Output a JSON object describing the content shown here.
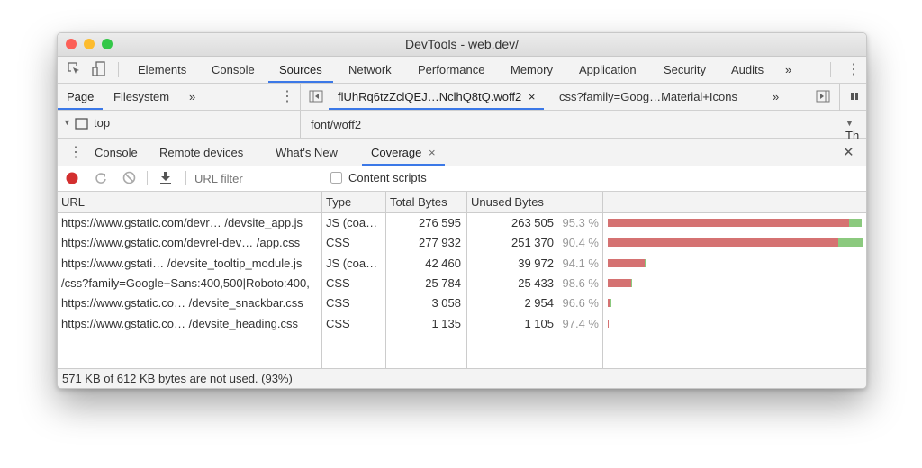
{
  "window": {
    "title": "DevTools - web.dev/",
    "traffic_lights": {
      "close": "#fc5f57",
      "minimize": "#fdbc2e",
      "zoom": "#33c748"
    }
  },
  "main_tabs": {
    "items": [
      {
        "label": "Elements"
      },
      {
        "label": "Console"
      },
      {
        "label": "Sources",
        "active": true
      },
      {
        "label": "Network"
      },
      {
        "label": "Performance"
      },
      {
        "label": "Memory"
      },
      {
        "label": "Application"
      },
      {
        "label": "Security"
      },
      {
        "label": "Audits"
      }
    ],
    "overflow": "»",
    "menu": "⋮"
  },
  "sources": {
    "nav_tabs": [
      {
        "label": "Page",
        "active": true
      },
      {
        "label": "Filesystem"
      }
    ],
    "nav_overflow": "»",
    "file_tabs": [
      {
        "label": "flUhRq6tzZclQEJ…NclhQ8tQ.woff2",
        "active": true,
        "close": "×"
      },
      {
        "label": "css?family=Goog…Material+Icons"
      }
    ],
    "file_overflow": "»",
    "tree_root": "top",
    "tree_arrow": "▼",
    "editor_content": "font/woff2",
    "right_pane_label": "Th"
  },
  "drawer": {
    "tabs": [
      {
        "label": "Console"
      },
      {
        "label": "Remote devices"
      },
      {
        "label": "What's New"
      },
      {
        "label": "Coverage",
        "active": true,
        "close": "×"
      }
    ],
    "close": "✕"
  },
  "coverage": {
    "url_filter_placeholder": "URL filter",
    "content_scripts_label": "Content scripts",
    "content_scripts_checked": false,
    "columns": [
      "URL",
      "Type",
      "Total Bytes",
      "Unused Bytes",
      ""
    ],
    "colors": {
      "unused": "#d57272",
      "used": "#8bc97e"
    },
    "rows": [
      {
        "url": "https://www.gstatic.com/devr… /devsite_app.js",
        "type": "JS (coa…",
        "total": "276 595",
        "unused": "263 505",
        "pct": "95.3 %",
        "total_bytes": 276595,
        "unused_bytes": 263505
      },
      {
        "url": "https://www.gstatic.com/devrel-dev… /app.css",
        "type": "CSS",
        "total": "277 932",
        "unused": "251 370",
        "pct": "90.4 %",
        "total_bytes": 277932,
        "unused_bytes": 251370
      },
      {
        "url": "https://www.gstati… /devsite_tooltip_module.js",
        "type": "JS (coa…",
        "total": "42 460",
        "unused": "39 972",
        "pct": "94.1 %",
        "total_bytes": 42460,
        "unused_bytes": 39972
      },
      {
        "url": "/css?family=Google+Sans:400,500|Roboto:400,",
        "type": "CSS",
        "total": "25 784",
        "unused": "25 433",
        "pct": "98.6 %",
        "total_bytes": 25784,
        "unused_bytes": 25433
      },
      {
        "url": "https://www.gstatic.co… /devsite_snackbar.css",
        "type": "CSS",
        "total": "3 058",
        "unused": "2 954",
        "pct": "96.6 %",
        "total_bytes": 3058,
        "unused_bytes": 2954
      },
      {
        "url": "https://www.gstatic.co…  /devsite_heading.css",
        "type": "CSS",
        "total": "1 135",
        "unused": "1 105",
        "pct": "97.4 %",
        "total_bytes": 1135,
        "unused_bytes": 1105
      }
    ],
    "status": "571 KB of 612 KB bytes are not used. (93%)"
  }
}
